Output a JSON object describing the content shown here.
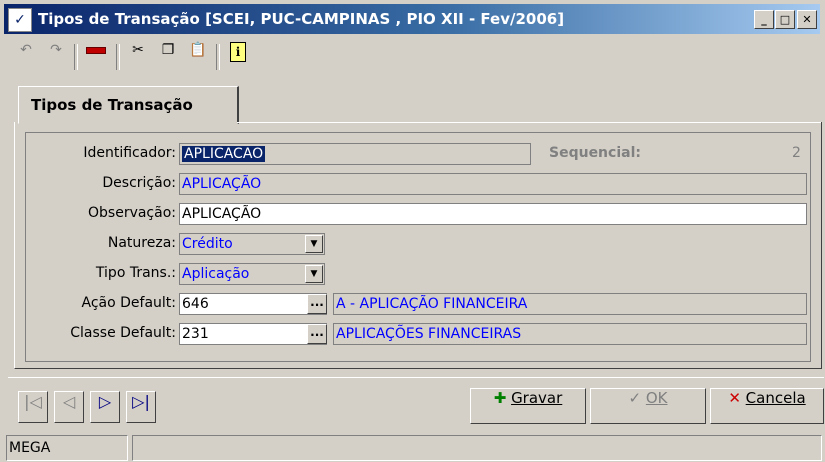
{
  "window": {
    "title": "Tipos de Transação [SCEI, PUC-CAMPINAS , PIO XII - Fev/2006]",
    "minimize_icon": "minimize-icon",
    "maximize_icon": "maximize-icon",
    "close_icon": "close-icon"
  },
  "toolbar": {
    "icons": [
      "undo-icon",
      "redo-icon",
      "delete-icon",
      "cut-icon",
      "copy-icon",
      "paste-icon",
      "info-icon"
    ]
  },
  "tabs": [
    {
      "label": "Tipos de Transação"
    }
  ],
  "form": {
    "identificador": {
      "label": "Identificador:",
      "value": "APLICACAO"
    },
    "sequencial": {
      "label": "Sequencial:",
      "value": "2"
    },
    "descricao": {
      "label": "Descrição:",
      "value": "APLICAÇÃO"
    },
    "observacao": {
      "label": "Observação:",
      "value": "APLICAÇÃO"
    },
    "natureza": {
      "label": "Natureza:",
      "value": "Crédito"
    },
    "tipo_trans": {
      "label": "Tipo Trans.:",
      "value": "Aplicação"
    },
    "acao_default": {
      "label": "Ação Default:",
      "code": "646",
      "description": "A - APLICAÇÃO FINANCEIRA"
    },
    "classe_default": {
      "label": "Classe Default:",
      "code": "231",
      "description": "APLICAÇÕES FINANCEIRAS"
    }
  },
  "navigation": {
    "icons": [
      "first-record-icon",
      "previous-record-icon",
      "next-record-icon",
      "last-record-icon"
    ]
  },
  "actions": {
    "gravar": "Gravar",
    "ok": "OK",
    "cancela": "Cancela"
  },
  "statusbar": {
    "left": "MEGA"
  },
  "colors": {
    "title_start": "#0a246a",
    "title_end": "#a6caf0",
    "selection": "#0a246a",
    "readonly_text": "#0000ff"
  }
}
